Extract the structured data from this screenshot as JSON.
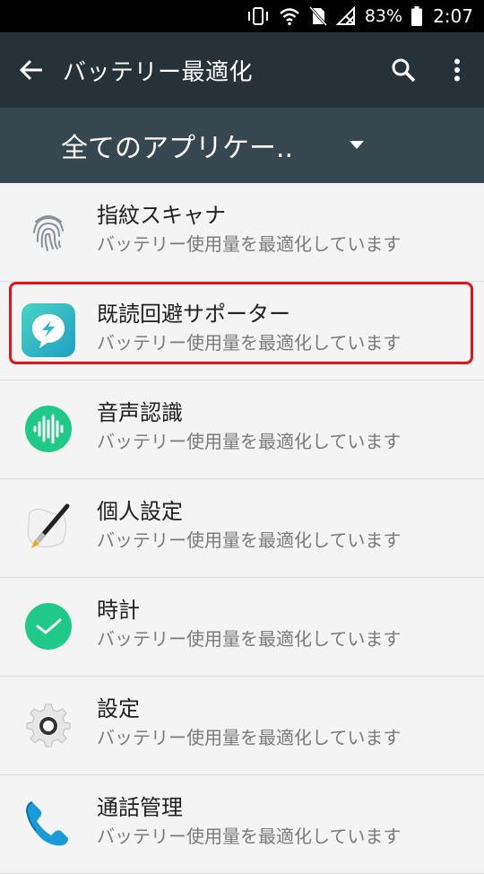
{
  "status_bar": {
    "battery_percent": "83%",
    "time": "2:07",
    "icons": [
      "vibrate-icon",
      "wifi-icon",
      "no-sim-icon",
      "no-signal-icon",
      "battery-icon"
    ]
  },
  "app_bar": {
    "title": "バッテリー最適化",
    "back_icon": "arrow-back-icon",
    "search_icon": "search-icon",
    "more_icon": "more-vert-icon"
  },
  "filter": {
    "selected": "全てのアプリケー.."
  },
  "apps": [
    {
      "name": "指紋スキャナ",
      "status": "バッテリー使用量を最適化しています",
      "icon": "fingerprint-icon"
    },
    {
      "name": "既読回避サポーター",
      "status": "バッテリー使用量を最適化しています",
      "icon": "chat-bubble-app-icon"
    },
    {
      "name": "音声認識",
      "status": "バッテリー使用量を最適化しています",
      "icon": "voice-waveform-icon"
    },
    {
      "name": "個人設定",
      "status": "バッテリー使用量を最適化しています",
      "icon": "paintbrush-icon"
    },
    {
      "name": "時計",
      "status": "バッテリー使用量を最適化しています",
      "icon": "clock-check-icon"
    },
    {
      "name": "設定",
      "status": "バッテリー使用量を最適化しています",
      "icon": "gear-icon"
    },
    {
      "name": "通話管理",
      "status": "バッテリー使用量を最適化しています",
      "icon": "phone-icon"
    }
  ],
  "colors": {
    "app_bar": "#263238",
    "filter_bar": "#37474f",
    "highlight": "#e0151b",
    "accent_green": "#1fc98a"
  }
}
